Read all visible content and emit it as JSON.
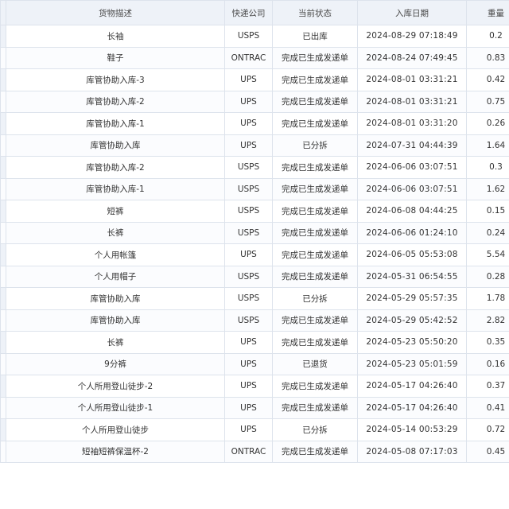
{
  "table": {
    "headers": {
      "description": "货物描述",
      "carrier": "快递公司",
      "status": "当前状态",
      "date": "入库日期",
      "weight": "重量"
    },
    "rows": [
      {
        "description": "长袖",
        "carrier": "USPS",
        "status": "已出库",
        "date": "2024-08-29 07:18:49",
        "weight": "0.2"
      },
      {
        "description": "鞋子",
        "carrier": "ONTRAC",
        "status": "完成已生成发递单",
        "date": "2024-08-24 07:49:45",
        "weight": "0.83"
      },
      {
        "description": "库管协助入库-3",
        "carrier": "UPS",
        "status": "完成已生成发递单",
        "date": "2024-08-01 03:31:21",
        "weight": "0.42"
      },
      {
        "description": "库管协助入库-2",
        "carrier": "UPS",
        "status": "完成已生成发递单",
        "date": "2024-08-01 03:31:21",
        "weight": "0.75"
      },
      {
        "description": "库管协助入库-1",
        "carrier": "UPS",
        "status": "完成已生成发递单",
        "date": "2024-08-01 03:31:20",
        "weight": "0.26"
      },
      {
        "description": "库管协助入库",
        "carrier": "UPS",
        "status": "已分拆",
        "date": "2024-07-31 04:44:39",
        "weight": "1.64"
      },
      {
        "description": "库管协助入库-2",
        "carrier": "USPS",
        "status": "完成已生成发递单",
        "date": "2024-06-06 03:07:51",
        "weight": "0.3"
      },
      {
        "description": "库管协助入库-1",
        "carrier": "USPS",
        "status": "完成已生成发递单",
        "date": "2024-06-06 03:07:51",
        "weight": "1.62"
      },
      {
        "description": "短裤",
        "carrier": "USPS",
        "status": "完成已生成发递单",
        "date": "2024-06-08 04:44:25",
        "weight": "0.15"
      },
      {
        "description": "长裤",
        "carrier": "USPS",
        "status": "完成已生成发递单",
        "date": "2024-06-06 01:24:10",
        "weight": "0.24"
      },
      {
        "description": "个人用帐篷",
        "carrier": "UPS",
        "status": "完成已生成发递单",
        "date": "2024-06-05 05:53:08",
        "weight": "5.54"
      },
      {
        "description": "个人用帽子",
        "carrier": "USPS",
        "status": "完成已生成发递单",
        "date": "2024-05-31 06:54:55",
        "weight": "0.28"
      },
      {
        "description": "库管协助入库",
        "carrier": "USPS",
        "status": "已分拆",
        "date": "2024-05-29 05:57:35",
        "weight": "1.78"
      },
      {
        "description": "库管协助入库",
        "carrier": "USPS",
        "status": "完成已生成发递单",
        "date": "2024-05-29 05:42:52",
        "weight": "2.82"
      },
      {
        "description": "长裤",
        "carrier": "UPS",
        "status": "完成已生成发递单",
        "date": "2024-05-23 05:50:20",
        "weight": "0.35"
      },
      {
        "description": "9分裤",
        "carrier": "UPS",
        "status": "已退货",
        "date": "2024-05-23 05:01:59",
        "weight": "0.16"
      },
      {
        "description": "个人所用登山徒步-2",
        "carrier": "UPS",
        "status": "完成已生成发递单",
        "date": "2024-05-17 04:26:40",
        "weight": "0.37"
      },
      {
        "description": "个人所用登山徒步-1",
        "carrier": "UPS",
        "status": "完成已生成发递单",
        "date": "2024-05-17 04:26:40",
        "weight": "0.41"
      },
      {
        "description": "个人所用登山徒步",
        "carrier": "UPS",
        "status": "已分拆",
        "date": "2024-05-14 00:53:29",
        "weight": "0.72"
      },
      {
        "description": "短袖短裤保温杯-2",
        "carrier": "ONTRAC",
        "status": "完成已生成发递单",
        "date": "2024-05-08 07:17:03",
        "weight": "0.45"
      }
    ]
  }
}
